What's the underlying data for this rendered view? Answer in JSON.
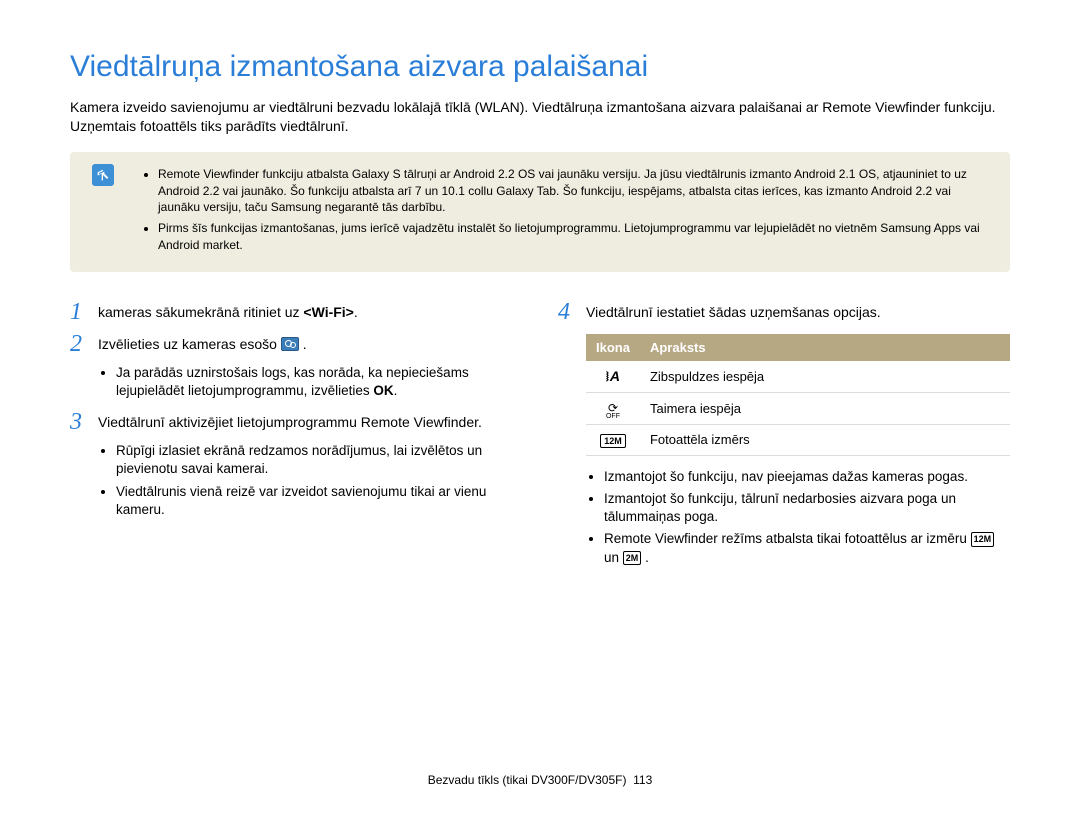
{
  "title": "Viedtālruņa izmantošana aizvara palaišanai",
  "intro": "Kamera izveido savienojumu ar viedtālruni bezvadu lokālajā tīklā (WLAN). Viedtālruņa izmantošana aizvara palaišanai ar Remote Viewfinder funkciju. Uzņemtais fotoattēls tiks parādīts viedtālrunī.",
  "notes": [
    "Remote Viewfinder funkciju atbalsta Galaxy S tālruņi ar Android 2.2 OS vai jaunāku versiju. Ja jūsu viedtālrunis izmanto Android 2.1 OS, atjauniniet to uz Android 2.2 vai jaunāko. Šo funkciju atbalsta arī 7 un 10.1 collu Galaxy Tab. Šo funkciju, iespējams, atbalsta citas ierīces, kas izmanto Android 2.2 vai jaunāku versiju, taču Samsung negarantē tās darbību.",
    "Pirms šīs funkcijas izmantošanas, jums ierīcē vajadzētu instalēt šo lietojumprogrammu. Lietojumprogrammu var lejupielādēt no vietnēm Samsung Apps vai Android market."
  ],
  "steps_left": {
    "s1": {
      "num": "1",
      "text_pre": "kameras sākumekrānā ritiniet uz ",
      "text_em": "<Wi-Fi>",
      "text_post": "."
    },
    "s2": {
      "num": "2",
      "text_pre": "Izvēlieties uz kameras esošo ",
      "text_post": " ."
    },
    "s2_sub_pre": "Ja parādās uznirstošais logs, kas norāda, ka nepieciešams lejupielādēt lietojumprogrammu, izvēlieties ",
    "s2_sub_em": "OK",
    "s2_sub_post": ".",
    "s3": {
      "num": "3",
      "text": "Viedtālrunī aktivizējiet lietojumprogrammu Remote Viewfinder."
    },
    "s3_subs": [
      "Rūpīgi izlasiet ekrānā redzamos norādījumus, lai izvēlētos un pievienotu savai kamerai.",
      "Viedtālrunis vienā reizē var izveidot savienojumu tikai ar vienu kameru."
    ]
  },
  "steps_right": {
    "s4": {
      "num": "4",
      "text": "Viedtālrunī iestatiet šādas uzņemšanas opcijas."
    },
    "table": {
      "h1": "Ikona",
      "h2": "Apraksts",
      "rows": [
        {
          "desc": "Zibspuldzes iespēja"
        },
        {
          "desc": "Taimera iespēja"
        },
        {
          "desc": "Fotoattēla izmērs"
        }
      ]
    },
    "notes": [
      "Izmantojot šo funkciju, nav pieejamas dažas kameras pogas.",
      "Izmantojot šo funkciju, tālrunī nedarbosies aizvara poga un tālummaiņas poga."
    ],
    "note3_pre": "Remote Viewfinder režīms atbalsta tikai fotoattēlus ar izmēru ",
    "note3_mid": " un ",
    "note3_post": ".",
    "size1": "12M",
    "size2": "2M"
  },
  "footer": {
    "text": "Bezvadu tīkls (tikai DV300F/DV305F)",
    "page": "113"
  }
}
